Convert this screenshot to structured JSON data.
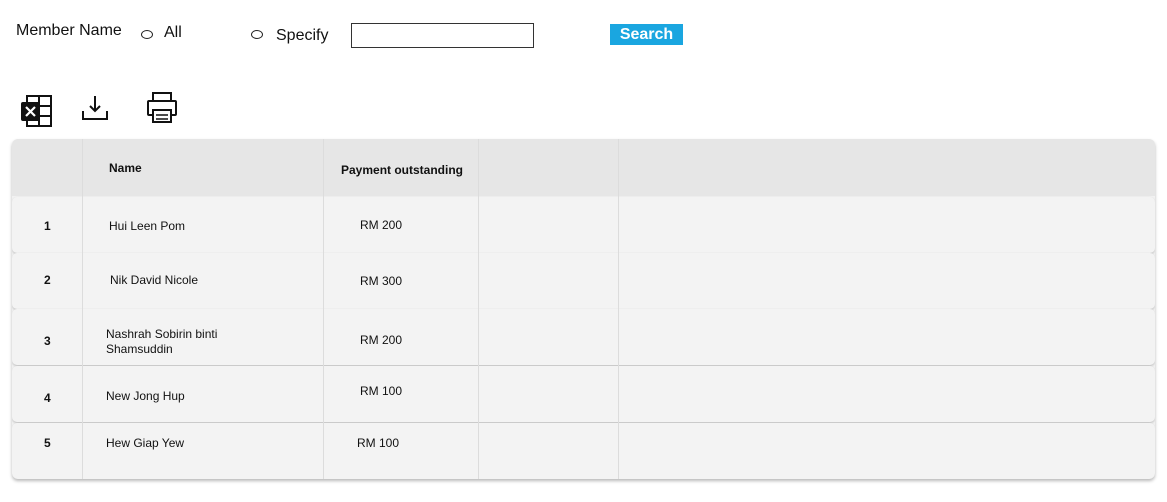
{
  "filter": {
    "label": "Member Name",
    "option_all": "All",
    "option_specify": "Specify",
    "input_value": "",
    "search_label": "Search"
  },
  "toolbar": {
    "icons": [
      "excel-icon",
      "download-icon",
      "print-icon"
    ]
  },
  "table": {
    "headers": [
      "",
      "Name",
      "Payment outstanding",
      "",
      ""
    ],
    "rows": [
      {
        "no": "1",
        "name_line1": "Hui Leen Pom",
        "name_line2": "",
        "payment": "RM 200"
      },
      {
        "no": "2",
        "name_line1": "Nik David Nicole",
        "name_line2": "",
        "payment": "RM 300"
      },
      {
        "no": "3",
        "name_line1": "Nashrah Sobirin binti",
        "name_line2": "Shamsuddin",
        "payment": "RM 200"
      },
      {
        "no": "4",
        "name_line1": "New Jong Hup",
        "name_line2": "",
        "payment": "RM 100"
      },
      {
        "no": "5",
        "name_line1": "Hew Giap Yew",
        "name_line2": "",
        "payment": "RM 100"
      }
    ]
  },
  "colors": {
    "search_button": "#1aa6e0",
    "header_bg": "#e6e6e6",
    "row_bg": "#f3f3f3"
  }
}
